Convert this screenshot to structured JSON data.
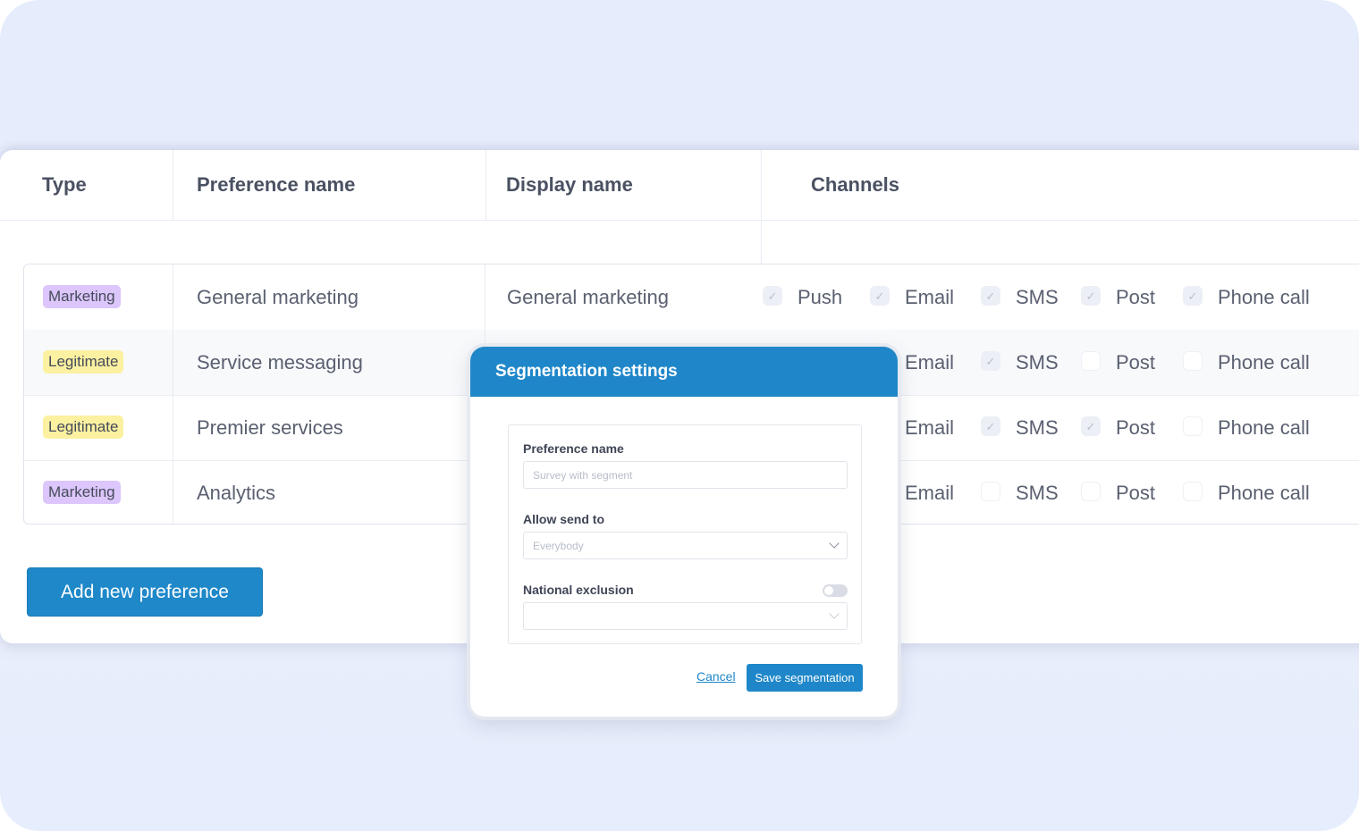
{
  "table": {
    "headers": {
      "type": "Type",
      "preference_name": "Preference name",
      "display_name": "Display name",
      "channels": "Channels"
    },
    "rows": [
      {
        "type": "Marketing",
        "type_color": "#dcc6fb",
        "preference_name": "General marketing",
        "display_name": "General marketing",
        "channels": [
          {
            "label": "Push",
            "checked": true
          },
          {
            "label": "Email",
            "checked": true
          },
          {
            "label": "SMS",
            "checked": true
          },
          {
            "label": "Post",
            "checked": true
          },
          {
            "label": "Phone call",
            "checked": true
          }
        ]
      },
      {
        "type": "Legitimate",
        "type_color": "#fbf1a0",
        "preference_name": "Service messaging",
        "display_name": "",
        "channels": [
          {
            "label": "Email",
            "checked": true
          },
          {
            "label": "SMS",
            "checked": true
          },
          {
            "label": "Post",
            "checked": false
          },
          {
            "label": "Phone call",
            "checked": false
          }
        ]
      },
      {
        "type": "Legitimate",
        "type_color": "#fbf1a0",
        "preference_name": "Premier services",
        "display_name": "",
        "channels": [
          {
            "label": "Email",
            "checked": true
          },
          {
            "label": "SMS",
            "checked": true
          },
          {
            "label": "Post",
            "checked": true
          },
          {
            "label": "Phone call",
            "checked": false
          }
        ]
      },
      {
        "type": "Marketing",
        "type_color": "#dcc6fb",
        "preference_name": "Analytics",
        "display_name": "",
        "channels": [
          {
            "label": "Email",
            "checked": false
          },
          {
            "label": "SMS",
            "checked": false
          },
          {
            "label": "Post",
            "checked": false
          },
          {
            "label": "Phone call",
            "checked": false
          }
        ]
      }
    ]
  },
  "add_button_label": "Add new preference",
  "modal": {
    "title": "Segmentation settings",
    "preference_name_label": "Preference name",
    "preference_name_placeholder": "Survey with segment",
    "allow_send_label": "Allow send to",
    "allow_send_value": "Everybody",
    "national_exclusion_label": "National exclusion",
    "national_exclusion_enabled": false,
    "cancel_label": "Cancel",
    "save_label": "Save segmentation"
  },
  "colors": {
    "accent": "#1f87c9",
    "marketing_badge": "#dcc6fb",
    "legitimate_badge": "#fbf1a0"
  }
}
